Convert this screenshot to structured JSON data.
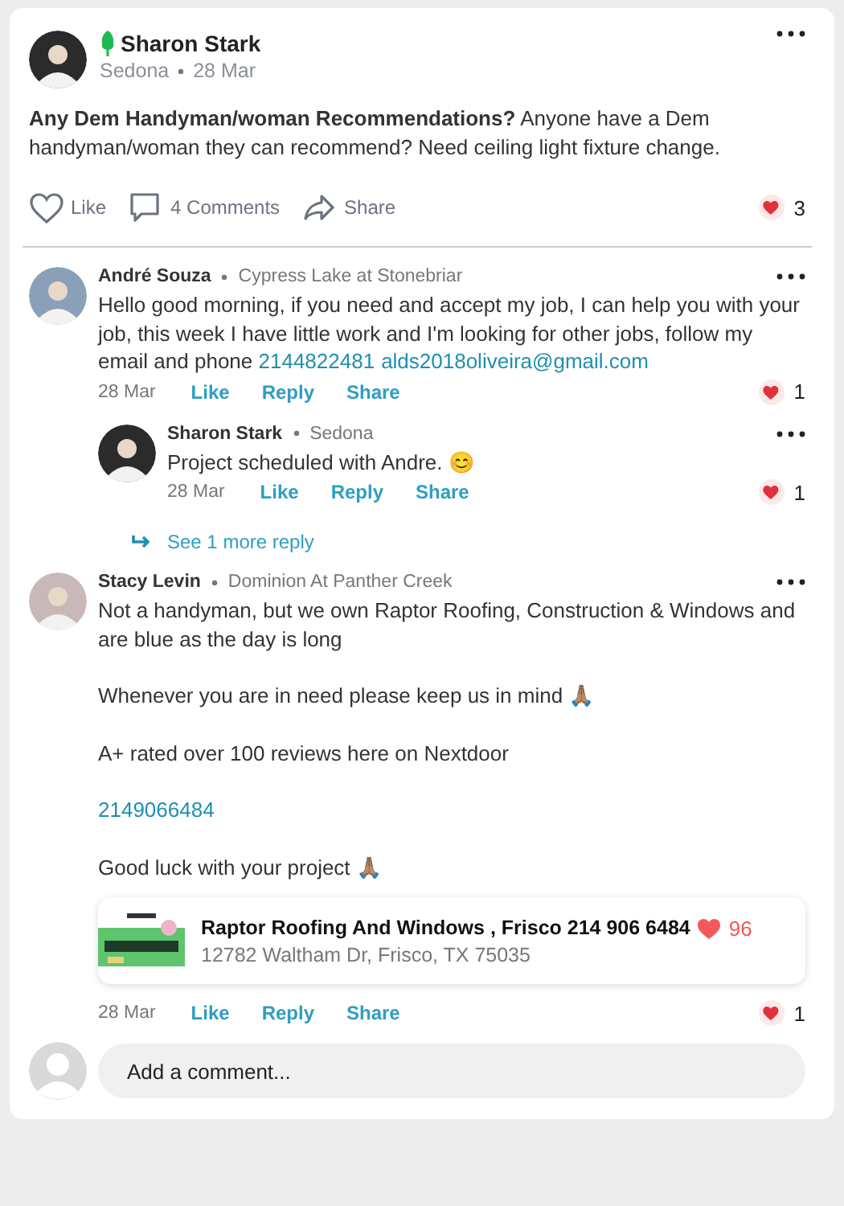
{
  "post": {
    "author": "Sharon Stark",
    "location": "Sedona",
    "date": "28 Mar",
    "text": "**Any Dem Handyman/woman Recommendations?** Anyone have a Dem handyman/woman they can recommend? Need ceiling light fixture change.",
    "actions": [
      {
        "kind": "like",
        "label": "Like"
      },
      {
        "kind": "comment",
        "label": "4 Comments"
      },
      {
        "kind": "share",
        "label": "Share"
      }
    ],
    "reactions": "3"
  },
  "comments": [
    {
      "author": "André Souza",
      "location": "Cypress Lake at Stonebriar",
      "paragraphs": [
        [
          {
            "kind": "text",
            "text": "Hello good morning, if you need and accept my job, I can help you with your job, this week I have little work and I'm looking for other jobs, follow my email and phone "
          },
          {
            "kind": "link",
            "text": "2144822481"
          },
          {
            "kind": "link",
            "text": "alds2018oliveira@gmail.com"
          }
        ]
      ],
      "date": "28 Mar",
      "actions": [
        "Like",
        "Reply",
        "Share"
      ],
      "reactions": "1",
      "replies": [
        {
          "author": "Sharon Stark",
          "location": "Sedona",
          "paragraphs": [
            [
              {
                "kind": "text",
                "text": "Project scheduled with Andre. 😊"
              }
            ]
          ],
          "date": "28 Mar",
          "actions": [
            "Like",
            "Reply",
            "Share"
          ],
          "reactions": "1"
        }
      ],
      "more_replies": "See 1 more reply"
    },
    {
      "author": "Stacy Levin",
      "location": "Dominion At Panther Creek",
      "paragraphs": [
        [
          {
            "kind": "text",
            "text": "Not a handyman,  but we own Raptor Roofing, Construction & Windows and are blue as the day is long"
          }
        ],
        [
          {
            "kind": "text",
            "text": "Whenever you are in need please keep us in mind 🙏🏽"
          }
        ],
        [
          {
            "kind": "text",
            "text": "A+ rated over 100 reviews here on Nextdoor"
          }
        ],
        [
          {
            "kind": "link",
            "text": "2149066484"
          }
        ],
        [
          {
            "kind": "text",
            "text": "Good luck with your project  🙏🏽"
          }
        ]
      ],
      "business": {
        "name": "Raptor Roofing And Windows , Frisco 214 906 6484",
        "favorites": "96",
        "address": "12782 Waltham Dr, Frisco, TX 75035"
      },
      "date": "28 Mar",
      "actions": [
        "Like",
        "Reply",
        "Share"
      ],
      "reactions": "1"
    }
  ],
  "composer": {
    "placeholder": "Add a comment..."
  }
}
